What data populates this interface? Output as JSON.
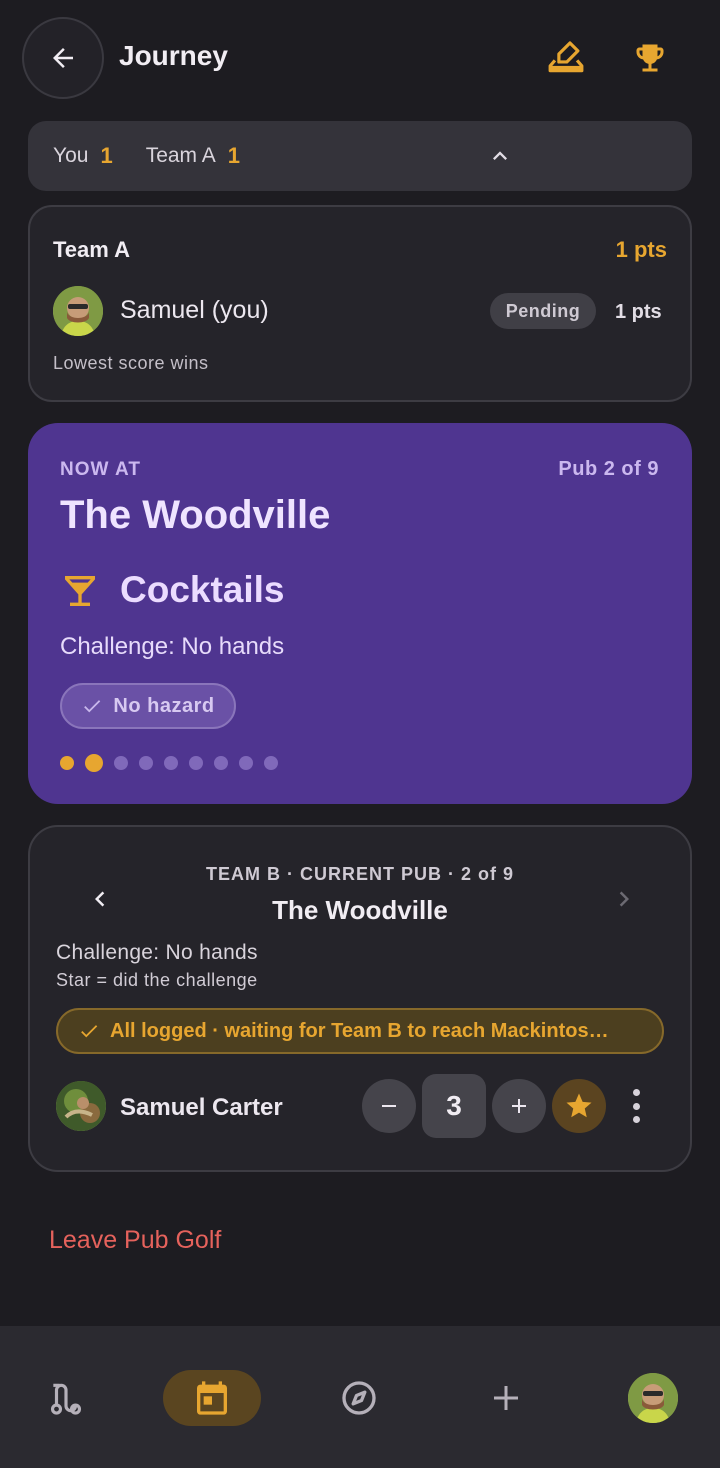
{
  "header": {
    "title": "Journey",
    "icons": [
      "arrow-left-icon",
      "scorecard-icon",
      "trophy-icon"
    ]
  },
  "score_strip": {
    "you_label": "You",
    "you_score": "1",
    "team_label": "Team A",
    "team_score": "1",
    "icon": "chevron-up-icon"
  },
  "team_card": {
    "team_name": "Team A",
    "team_points": "1 pts",
    "member_name": "Samuel (you)",
    "member_status": "Pending",
    "member_points": "1 pts",
    "rule": "Lowest score wins"
  },
  "now_card": {
    "eyebrow": "NOW AT",
    "pub_progress": "Pub 2 of 9",
    "pub_name": "The Woodville",
    "drink": "Cocktails",
    "drink_icon": "cocktail-icon",
    "challenge": "Challenge: No hands",
    "hazard": "No hazard",
    "total_pubs": 9,
    "current_pub": 2,
    "colors": {
      "card": "#4f3590",
      "accent": "#e7a630"
    }
  },
  "team_b_card": {
    "subtitle": "TEAM B · CURRENT PUB · 2 of 9",
    "pub_name": "The Woodville",
    "challenge": "Challenge: No hands",
    "star_note": "Star = did the challenge",
    "status": "All logged · waiting for Team B to reach Mackintos…",
    "player": {
      "name": "Samuel Carter",
      "score": "3"
    }
  },
  "leave_label": "Leave Pub Golf",
  "bottom_nav": {
    "items": [
      "route-icon",
      "calendar-icon",
      "compass-icon",
      "plus-icon",
      "profile-avatar"
    ],
    "active": "calendar-icon"
  }
}
